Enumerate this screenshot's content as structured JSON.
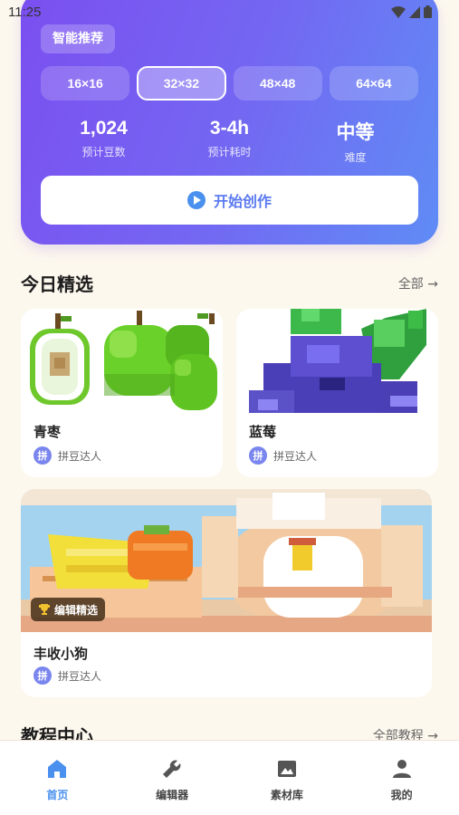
{
  "status_bar": {
    "time": "11:25"
  },
  "hero": {
    "tag": "智能推荐",
    "sizes": [
      {
        "label": "16×16",
        "active": false
      },
      {
        "label": "32×32",
        "active": true
      },
      {
        "label": "48×48",
        "active": false
      },
      {
        "label": "64×64",
        "active": false
      }
    ],
    "stats": [
      {
        "value": "1,024",
        "label": "预计豆数"
      },
      {
        "value": "3-4h",
        "label": "预计耗时"
      },
      {
        "value": "中等",
        "label": "难度"
      }
    ],
    "start_label": "开始创作"
  },
  "featured": {
    "title": "今日精选",
    "more": "全部 →",
    "cards": [
      {
        "title": "青枣",
        "author": "拼豆达人",
        "avatar": "拼"
      },
      {
        "title": "蓝莓",
        "author": "拼豆达人",
        "avatar": "拼"
      },
      {
        "title": "丰收小狗",
        "author": "拼豆达人",
        "avatar": "拼",
        "badge": "编辑精选"
      }
    ]
  },
  "tutorials": {
    "title": "教程中心",
    "more": "全部教程 →"
  },
  "nav": {
    "items": [
      {
        "label": "首页",
        "icon": "home-icon",
        "active": true
      },
      {
        "label": "编辑器",
        "icon": "wrench-icon",
        "active": false
      },
      {
        "label": "素材库",
        "icon": "image-icon",
        "active": false
      },
      {
        "label": "我的",
        "icon": "person-icon",
        "active": false
      }
    ]
  },
  "colors": {
    "accent": "#4a90ee",
    "hero_gradient_start": "#7b4ff0",
    "hero_gradient_end": "#5f8cf5",
    "background": "#fdf8ee"
  }
}
